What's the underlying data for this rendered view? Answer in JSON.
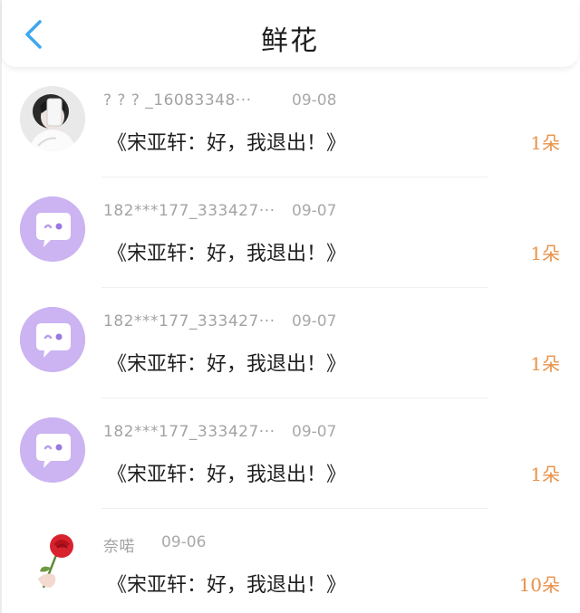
{
  "header": {
    "title": "鲜花",
    "back_icon": "chevron-left-icon",
    "accent_color": "#3ea6ee"
  },
  "items": [
    {
      "avatar": "photo-avatar",
      "name": "? ? ? _16083348···",
      "date": "09-08",
      "message": "《宋亚轩：好，我退出！》",
      "count": "1朵"
    },
    {
      "avatar": "chat-bubble-avatar",
      "name": "182***177_333427···",
      "date": "09-07",
      "message": "《宋亚轩：好，我退出！》",
      "count": "1朵"
    },
    {
      "avatar": "chat-bubble-avatar",
      "name": "182***177_333427···",
      "date": "09-07",
      "message": "《宋亚轩：好，我退出！》",
      "count": "1朵"
    },
    {
      "avatar": "chat-bubble-avatar",
      "name": "182***177_333427···",
      "date": "09-07",
      "message": "《宋亚轩：好，我退出！》",
      "count": "1朵"
    },
    {
      "avatar": "rose-avatar",
      "name": "奈喏",
      "date": "09-06",
      "message": "《宋亚轩：好，我退出！》",
      "count": "10朵"
    }
  ],
  "colors": {
    "avatar_purple": "#cbb4f1",
    "count_orange": "#e99147",
    "meta_gray": "#a3a3a3"
  }
}
